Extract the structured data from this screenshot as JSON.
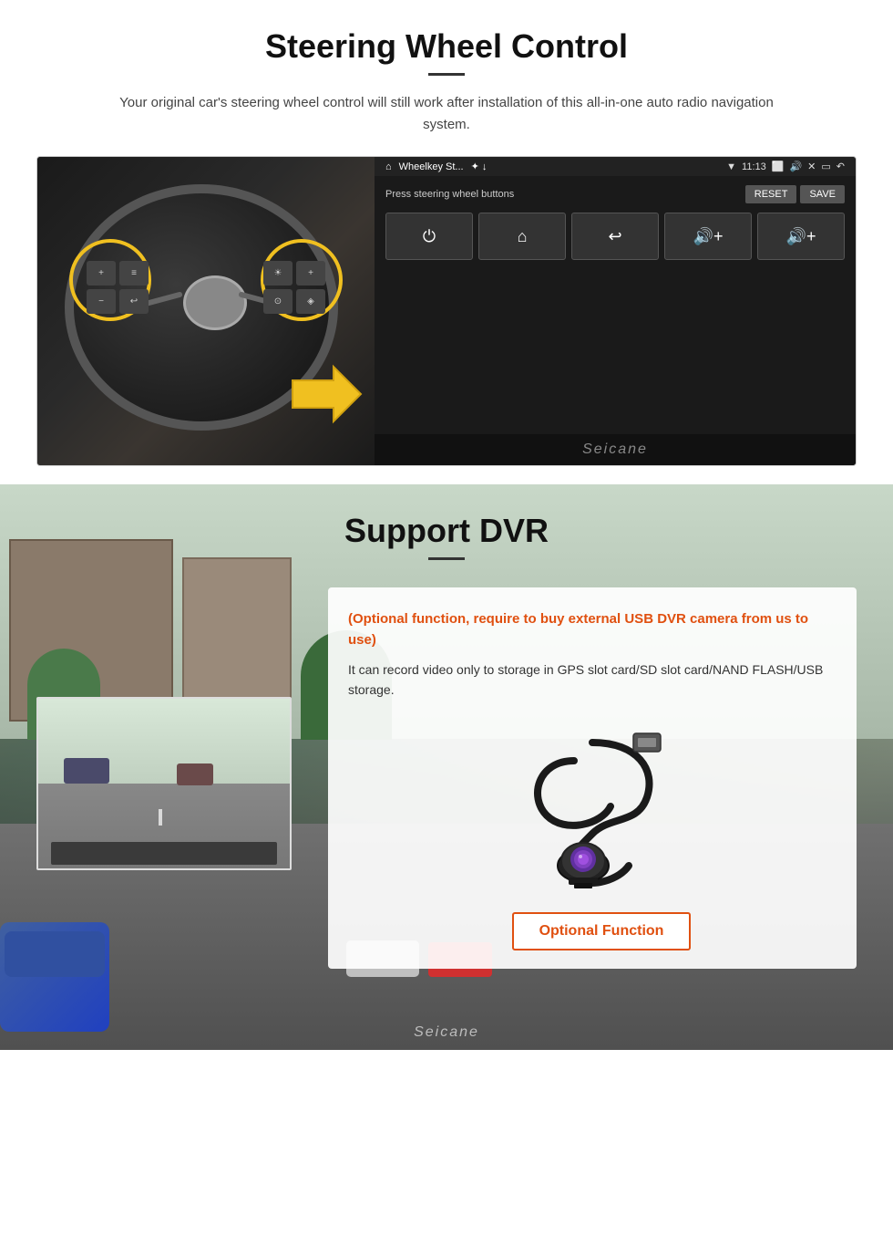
{
  "steering": {
    "title": "Steering Wheel Control",
    "subtitle": "Your original car's steering wheel control will still work after installation of this all-in-one auto radio navigation system.",
    "hu": {
      "app_name": "Wheelkey St...",
      "time": "11:13",
      "instruction": "Press steering wheel buttons",
      "reset_label": "RESET",
      "save_label": "SAVE",
      "controls": [
        "⏻",
        "⌂",
        "↩",
        "🔊+",
        "🔊+"
      ]
    },
    "seicane_watermark": "Seicane"
  },
  "dvr": {
    "title": "Support DVR",
    "optional_notice": "(Optional function, require to buy external USB DVR camera from us to use)",
    "description": "It can record video only to storage in GPS slot card/SD slot card/NAND FLASH/USB storage.",
    "optional_button_label": "Optional Function",
    "seicane_watermark": "Seicane"
  }
}
